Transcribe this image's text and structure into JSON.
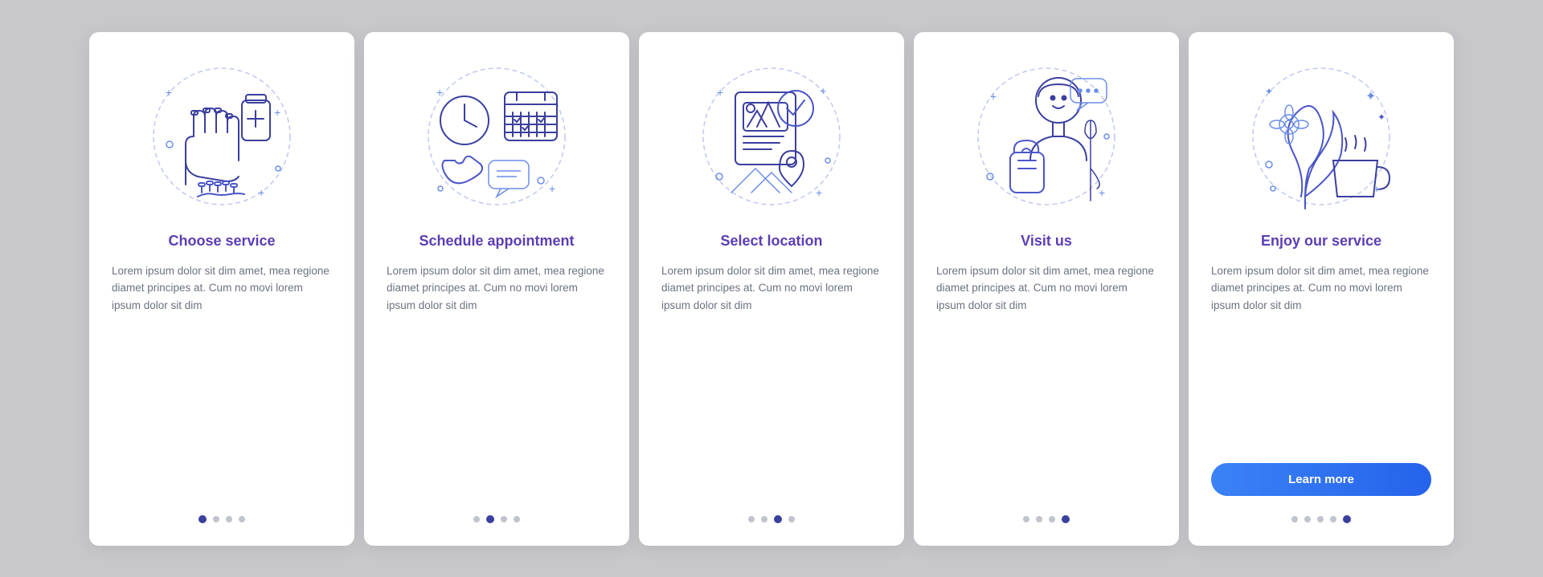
{
  "cards": [
    {
      "id": "choose-service",
      "title": "Choose service",
      "body": "Lorem ipsum dolor sit dim amet, mea regione diamet principes at. Cum no movi lorem ipsum dolor sit dim",
      "active_dot": 0,
      "dots": 4
    },
    {
      "id": "schedule-appointment",
      "title": "Schedule appointment",
      "body": "Lorem ipsum dolor sit dim amet, mea regione diamet principes at. Cum no movi lorem ipsum dolor sit dim",
      "active_dot": 1,
      "dots": 4
    },
    {
      "id": "select-location",
      "title": "Select location",
      "body": "Lorem ipsum dolor sit dim amet, mea regione diamet principes at. Cum no movi lorem ipsum dolor sit dim",
      "active_dot": 2,
      "dots": 4
    },
    {
      "id": "visit-us",
      "title": "Visit us",
      "body": "Lorem ipsum dolor sit dim amet, mea regione diamet principes at. Cum no movi lorem ipsum dolor sit dim",
      "active_dot": 3,
      "dots": 4
    },
    {
      "id": "enjoy-service",
      "title": "Enjoy our service",
      "body": "Lorem ipsum dolor sit dim amet, mea regione diamet principes at. Cum no movi lorem ipsum dolor sit dim",
      "active_dot": 4,
      "dots": 5,
      "has_button": true,
      "button_label": "Learn more"
    }
  ]
}
